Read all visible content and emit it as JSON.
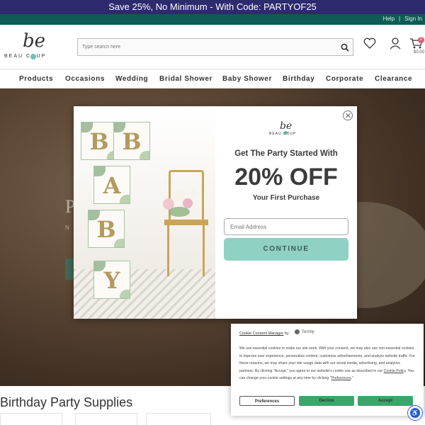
{
  "promo_bar": {
    "text": "Save 25%, No Minimum - With Code: PARTYOF25"
  },
  "utility_bar": {
    "help": "Help",
    "separator": "|",
    "sign_in": "Sign In"
  },
  "header": {
    "logo": {
      "monogram": "be",
      "wordmark": "BEAU COUP"
    },
    "search": {
      "placeholder": "Type search here",
      "icon": "search-icon"
    },
    "icons": [
      "heart-icon",
      "account-icon",
      "cart-icon"
    ],
    "cart": {
      "count": "0",
      "total": "$0.00"
    }
  },
  "nav": {
    "items": [
      "Products",
      "Occasions",
      "Wedding",
      "Bridal Shower",
      "Baby Shower",
      "Birthday",
      "Corporate",
      "Clearance"
    ]
  },
  "hero": {
    "title": "P",
    "subtitle": "N"
  },
  "section": {
    "title": "Birthday Party Supplies"
  },
  "modal": {
    "logo": {
      "monogram": "be",
      "wordmark": "BEAU COUP"
    },
    "headline": "Get The Party Started With",
    "offer": "20% OFF",
    "subline": "Your First Purchase",
    "email_placeholder": "Email Address",
    "cta": "CONTINUE",
    "image_letters": [
      "B",
      "B",
      "A",
      "B",
      "Y"
    ],
    "image_alt": "Baby blocks with a gold chair and flowers"
  },
  "cookie_banner": {
    "title": "Cookie Consent Manager",
    "by": "by",
    "brand": "Termly",
    "text_before_policy": "We use essential cookies to make our site work. With your consent, we may also use non-essential cookies to improve user experience, personalize content, customize advertisements, and analyze website traffic. For these reasons, we may share your site usage data with our social media, advertising, and analytics partners. By clicking \"Accept,\" you agree to our website's cookie use as described in our ",
    "policy_link": "Cookie Policy",
    "text_after_policy": ". You can change your cookie settings at any time by clicking \"",
    "prefs_link": "Preferences",
    "text_end": ".\"",
    "buttons": {
      "preferences": "Preferences",
      "decline": "Decline",
      "accept": "Accept"
    },
    "colors": {
      "buttons": "#3da56b"
    }
  },
  "accessibility": {
    "icon": "accessibility-icon"
  },
  "colors": {
    "promo": "#2d2a6e",
    "utility": "#0f5b55",
    "accent": "#8fd1c2"
  }
}
